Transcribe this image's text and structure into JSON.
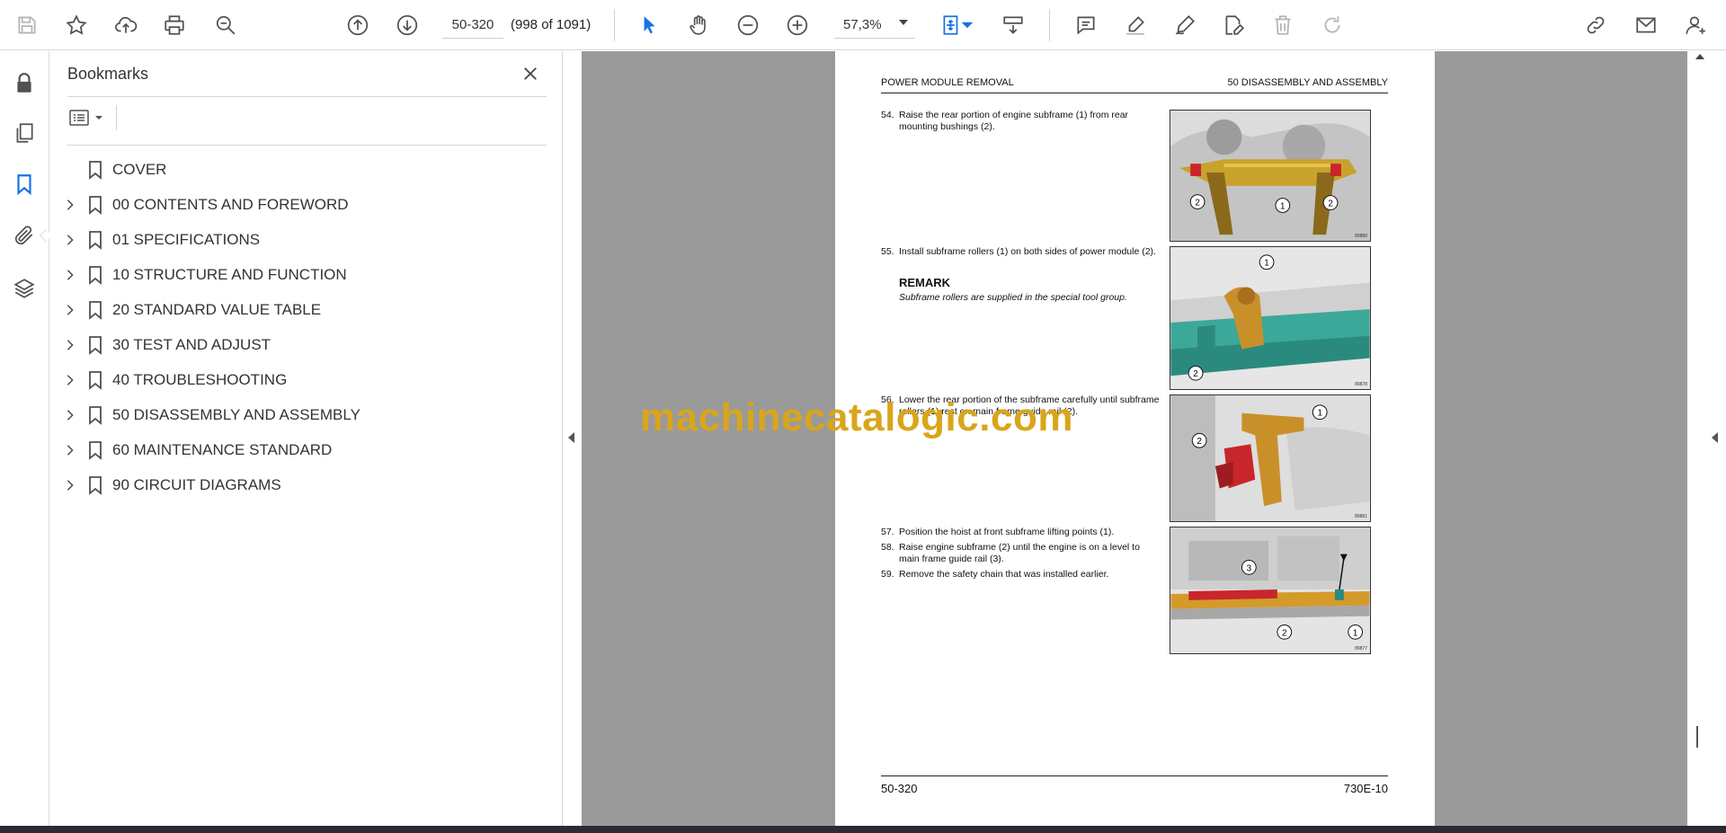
{
  "toolbar": {
    "current_page": "50-320",
    "page_count": "(998 of 1091)",
    "zoom": "57,3%"
  },
  "bookmarks": {
    "title": "Bookmarks",
    "items": [
      {
        "label": "COVER",
        "expandable": false
      },
      {
        "label": "00 CONTENTS AND FOREWORD",
        "expandable": true
      },
      {
        "label": "01 SPECIFICATIONS",
        "expandable": true
      },
      {
        "label": "10 STRUCTURE AND FUNCTION",
        "expandable": true
      },
      {
        "label": "20 STANDARD VALUE TABLE",
        "expandable": true
      },
      {
        "label": "30 TEST AND ADJUST",
        "expandable": true
      },
      {
        "label": "40 TROUBLESHOOTING",
        "expandable": true
      },
      {
        "label": "50 DISASSEMBLY AND ASSEMBLY",
        "expandable": true
      },
      {
        "label": "60 MAINTENANCE STANDARD",
        "expandable": true
      },
      {
        "label": "90 CIRCUIT DIAGRAMS",
        "expandable": true
      }
    ]
  },
  "document": {
    "header_left": "POWER MODULE REMOVAL",
    "header_right": "50 DISASSEMBLY AND ASSEMBLY",
    "steps": [
      {
        "num": "54.",
        "text": "Raise the rear portion of engine subframe (1) from rear mounting bushings (2)."
      },
      {
        "num": "55.",
        "text": "Install subframe rollers (1) on both sides of power module (2)."
      },
      {
        "num": "56.",
        "text": "Lower the rear portion of the subframe carefully until subframe rollers (1) rest on main frame guide rail (2)."
      },
      {
        "num": "57.",
        "text": "Position the hoist at front subframe lifting points (1)."
      },
      {
        "num": "58.",
        "text": "Raise engine subframe (2) until the engine is on a level to main frame guide rail (3)."
      },
      {
        "num": "59.",
        "text": "Remove the safety chain that was installed earlier."
      }
    ],
    "remark_title": "REMARK",
    "remark_text": "Subframe rollers are supplied in the special tool group.",
    "figures": [
      {
        "code": "89880",
        "callouts": [
          "2",
          "1",
          "2"
        ]
      },
      {
        "code": "89878",
        "callouts": [
          "1",
          "2"
        ]
      },
      {
        "code": "89881",
        "callouts": [
          "1",
          "2"
        ]
      },
      {
        "code": "89877",
        "callouts": [
          "3",
          "2",
          "1"
        ]
      }
    ],
    "footer_left": "50-320",
    "footer_right": "730E-10"
  },
  "watermark": "machinecatalogic.com",
  "colors": {
    "accent_blue": "#1473e6",
    "icon_gray": "#505050",
    "disabled_gray": "#b4b4b4",
    "watermark_gold": "#d9a51a",
    "doc_background": "#9a9a9a"
  }
}
